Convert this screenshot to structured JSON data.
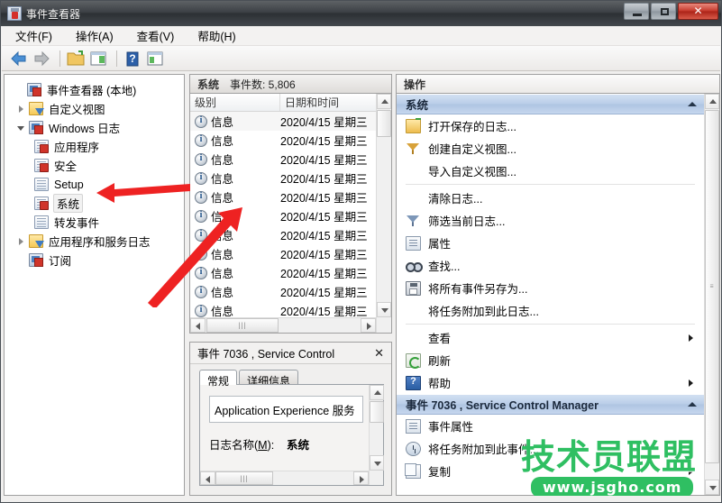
{
  "window": {
    "title": "事件查看器",
    "app_icon": "event-viewer-icon",
    "minimize_label": "",
    "maximize_label": "",
    "close_label": "✕"
  },
  "menu": [
    {
      "label": "文件(F)",
      "name": "menu-file"
    },
    {
      "label": "操作(A)",
      "name": "menu-action"
    },
    {
      "label": "查看(V)",
      "name": "menu-view"
    },
    {
      "label": "帮助(H)",
      "name": "menu-help"
    }
  ],
  "toolbar": [
    {
      "name": "back-icon",
      "icon": "back-arrow"
    },
    {
      "name": "forward-icon",
      "icon": "forward-arrow"
    },
    {
      "name": "open-folder-icon",
      "icon": "folder"
    },
    {
      "name": "show-tree-icon",
      "icon": "tree-pane"
    },
    {
      "name": "help-icon",
      "icon": "question-mark"
    },
    {
      "name": "show-action-pane-icon",
      "icon": "action-pane"
    }
  ],
  "tree": {
    "root": {
      "label": "事件查看器 (本地)",
      "icon": "event-viewer-icon"
    },
    "items": [
      {
        "label": "自定义视图",
        "icon": "custom-view-icon",
        "twisty": "closed",
        "indent": 1,
        "selected": false
      },
      {
        "label": "Windows 日志",
        "icon": "windows-logs-icon",
        "twisty": "open",
        "indent": 1,
        "selected": false
      },
      {
        "label": "应用程序",
        "icon": "log-warn-icon",
        "twisty": "none",
        "indent": 2,
        "selected": false
      },
      {
        "label": "安全",
        "icon": "log-warn-icon",
        "twisty": "none",
        "indent": 2,
        "selected": false
      },
      {
        "label": "Setup",
        "icon": "log-icon",
        "twisty": "none",
        "indent": 2,
        "selected": false
      },
      {
        "label": "系统",
        "icon": "log-warn-icon",
        "twisty": "none",
        "indent": 2,
        "selected": true
      },
      {
        "label": "转发事件",
        "icon": "log-icon",
        "twisty": "none",
        "indent": 2,
        "selected": false
      },
      {
        "label": "应用程序和服务日志",
        "icon": "custom-view-icon",
        "twisty": "closed",
        "indent": 1,
        "selected": false
      },
      {
        "label": "订阅",
        "icon": "subscription-icon",
        "twisty": "none",
        "indent": 1,
        "selected": false
      }
    ]
  },
  "events_pane": {
    "header_title": "系统",
    "header_count": "事件数: 5,806",
    "columns": [
      {
        "label": "级别",
        "name": "column-level"
      },
      {
        "label": "日期和时间",
        "name": "column-datetime"
      }
    ],
    "rows": [
      {
        "level": "信息",
        "datetime": "2020/4/15 星期三"
      },
      {
        "level": "信息",
        "datetime": "2020/4/15 星期三"
      },
      {
        "level": "信息",
        "datetime": "2020/4/15 星期三"
      },
      {
        "level": "信息",
        "datetime": "2020/4/15 星期三"
      },
      {
        "level": "信息",
        "datetime": "2020/4/15 星期三"
      },
      {
        "level": "信息",
        "datetime": "2020/4/15 星期三"
      },
      {
        "level": "信息",
        "datetime": "2020/4/15 星期三"
      },
      {
        "level": "信息",
        "datetime": "2020/4/15 星期三"
      },
      {
        "level": "信息",
        "datetime": "2020/4/15 星期三"
      },
      {
        "level": "信息",
        "datetime": "2020/4/15 星期三"
      },
      {
        "level": "信息",
        "datetime": "2020/4/15 星期三"
      }
    ]
  },
  "detail_pane": {
    "title": "事件 7036 , Service Control",
    "close_label": "✕",
    "tabs": [
      {
        "label": "常规",
        "active": true,
        "name": "tab-general"
      },
      {
        "label": "详细信息",
        "active": false,
        "name": "tab-details"
      }
    ],
    "message": "Application Experience 服务",
    "fields": [
      {
        "label_prefix": "日志名称(",
        "label_key": "M",
        "label_suffix": "):",
        "value": "系统"
      }
    ]
  },
  "actions_pane": {
    "header": "操作",
    "sections": [
      {
        "title": "系统",
        "name": "action-section-system",
        "items": [
          {
            "label": "打开保存的日志...",
            "icon": "open-saved-log-icon",
            "name": "action-open-saved-log",
            "submenu": false,
            "divider_after": false
          },
          {
            "label": "创建自定义视图...",
            "icon": "create-custom-view-icon",
            "name": "action-create-custom-view",
            "submenu": false,
            "divider_after": false
          },
          {
            "label": "导入自定义视图...",
            "icon": "none",
            "name": "action-import-custom-view",
            "submenu": false,
            "divider_after": true
          },
          {
            "label": "清除日志...",
            "icon": "none",
            "name": "action-clear-log",
            "submenu": false,
            "divider_after": false
          },
          {
            "label": "筛选当前日志...",
            "icon": "filter-icon",
            "name": "action-filter-current-log",
            "submenu": false,
            "divider_after": false
          },
          {
            "label": "属性",
            "icon": "properties-icon",
            "name": "action-properties",
            "submenu": false,
            "divider_after": false
          },
          {
            "label": "查找...",
            "icon": "find-icon",
            "name": "action-find",
            "submenu": false,
            "divider_after": false
          },
          {
            "label": "将所有事件另存为...",
            "icon": "save-icon",
            "name": "action-save-all-events",
            "submenu": false,
            "divider_after": false
          },
          {
            "label": "将任务附加到此日志...",
            "icon": "none",
            "name": "action-attach-task-to-log",
            "submenu": false,
            "divider_after": true
          },
          {
            "label": "查看",
            "icon": "none",
            "name": "action-view",
            "submenu": true,
            "divider_after": false
          },
          {
            "label": "刷新",
            "icon": "refresh-icon",
            "name": "action-refresh",
            "submenu": false,
            "divider_after": false
          },
          {
            "label": "帮助",
            "icon": "help-icon",
            "name": "action-help",
            "submenu": true,
            "divider_after": false
          }
        ]
      },
      {
        "title": "事件 7036 , Service Control Manager",
        "name": "action-section-event",
        "items": [
          {
            "label": "事件属性",
            "icon": "event-properties-icon",
            "name": "action-event-properties",
            "submenu": false,
            "divider_after": false
          },
          {
            "label": "将任务附加到此事件...",
            "icon": "attach-task-icon",
            "name": "action-attach-task-to-event",
            "submenu": false,
            "divider_after": false
          },
          {
            "label": "复制",
            "icon": "copy-icon",
            "name": "action-copy",
            "submenu": true,
            "divider_after": false
          }
        ]
      }
    ]
  },
  "watermark": {
    "text": "技术员联盟",
    "url": "www.jsgho.com",
    "color": "#2fbf62"
  },
  "annotations": {
    "arrow_color": "#ee2222",
    "arrow_system_label": "points-to-system-tree-node",
    "arrow_events_label": "points-to-event-list"
  }
}
